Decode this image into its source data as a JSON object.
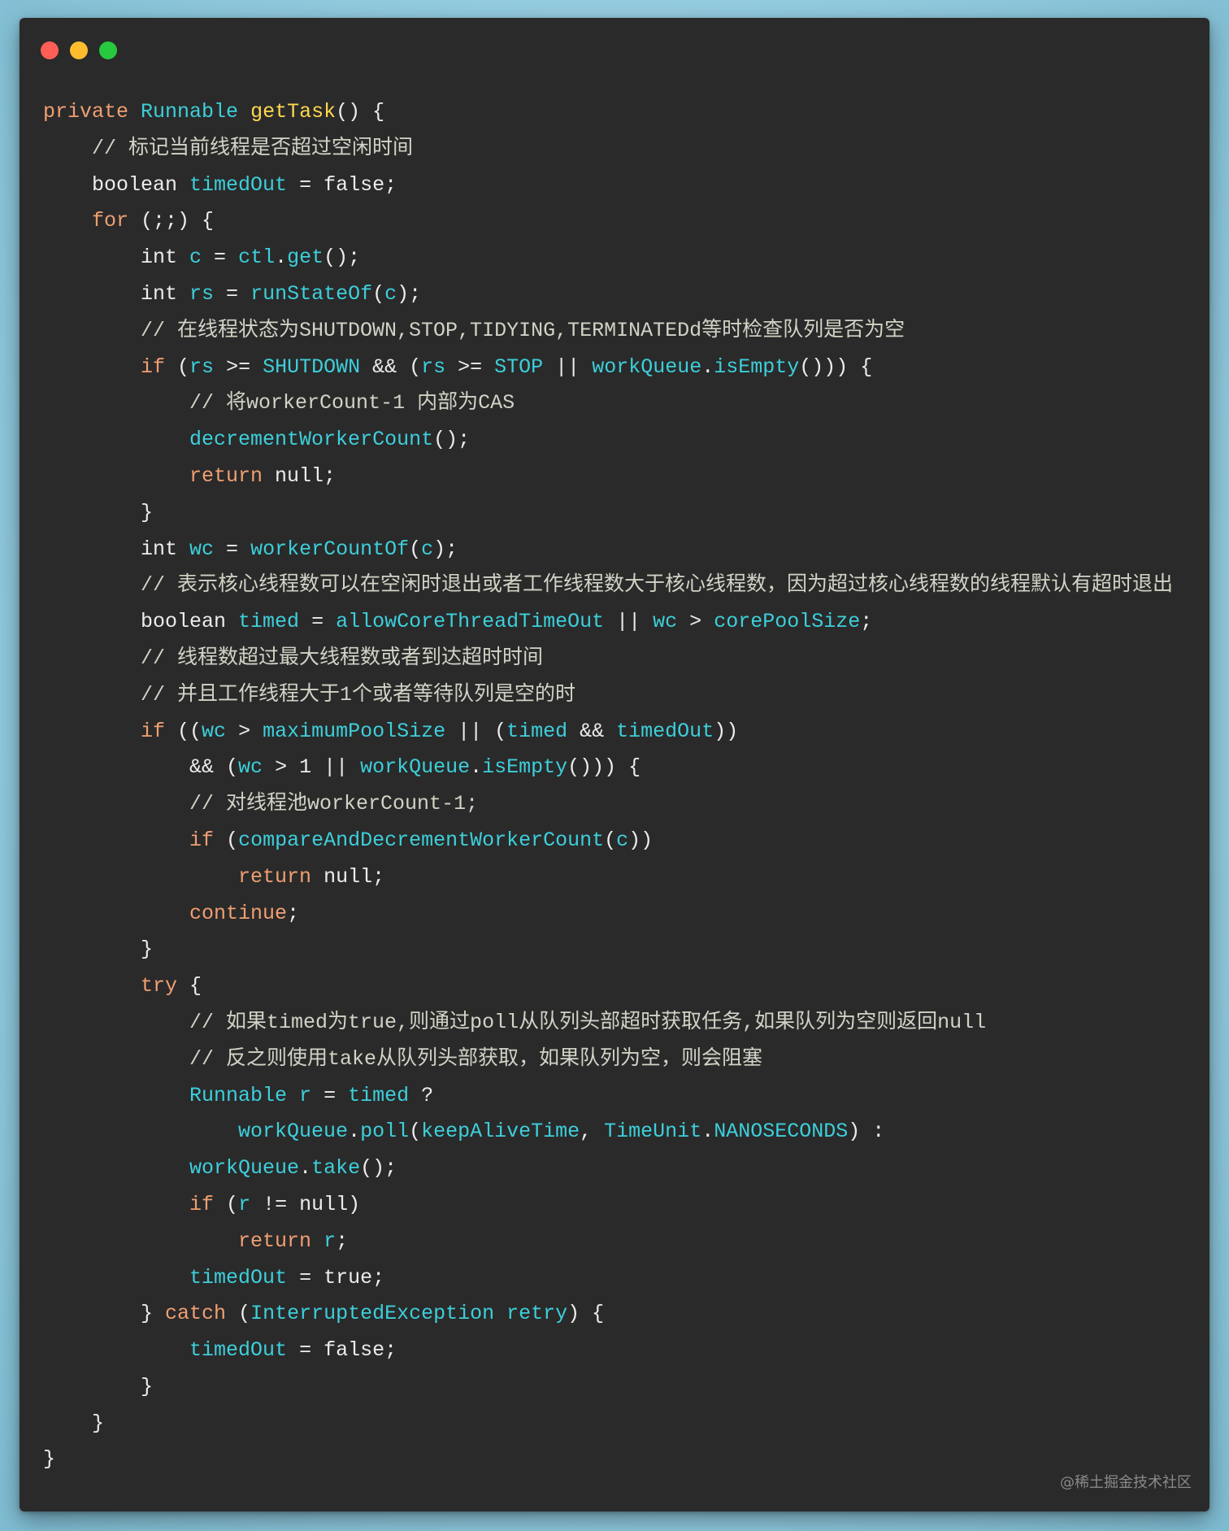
{
  "window": {
    "controls": [
      {
        "icon": "close-icon",
        "color": "#ff5f56"
      },
      {
        "icon": "minimize-icon",
        "color": "#ffbd2e"
      },
      {
        "icon": "maximize-icon",
        "color": "#27c93f"
      }
    ]
  },
  "theme": {
    "window_bg": "#2a2a2a",
    "keyword": "#f09f72",
    "identifier": "#3dcfdb",
    "function": "#ffd84d",
    "plain": "#ececec",
    "comment": "#d2d2c6",
    "watermark": "#8a8a8a"
  },
  "code": {
    "lines": [
      [
        {
          "kw": "private "
        },
        {
          "id": "Runnable "
        },
        {
          "fn": "getTask"
        },
        {
          "pl": "() {"
        }
      ],
      [
        {
          "cm": "    // 标记当前线程是否超过空闲时间"
        }
      ],
      [
        {
          "pl": "    boolean "
        },
        {
          "id": "timedOut"
        },
        {
          "pl": " = false;"
        }
      ],
      [
        {
          "kw": "    for"
        },
        {
          "pl": " (;;) {"
        }
      ],
      [
        {
          "pl": "        int "
        },
        {
          "id": "c"
        },
        {
          "pl": " = "
        },
        {
          "id": "ctl"
        },
        {
          "pl": "."
        },
        {
          "id": "get"
        },
        {
          "pl": "();"
        }
      ],
      [
        {
          "pl": "        int "
        },
        {
          "id": "rs"
        },
        {
          "pl": " = "
        },
        {
          "id": "runStateOf"
        },
        {
          "pl": "("
        },
        {
          "id": "c"
        },
        {
          "pl": ");"
        }
      ],
      [
        {
          "cm": "        // 在线程状态为SHUTDOWN,STOP,TIDYING,TERMINATEDd等时检查队列是否为空"
        }
      ],
      [
        {
          "kw": "        if"
        },
        {
          "pl": " ("
        },
        {
          "id": "rs"
        },
        {
          "pl": " >= "
        },
        {
          "id": "SHUTDOWN"
        },
        {
          "pl": " && ("
        },
        {
          "id": "rs"
        },
        {
          "pl": " >= "
        },
        {
          "id": "STOP"
        },
        {
          "pl": " || "
        },
        {
          "id": "workQueue"
        },
        {
          "pl": "."
        },
        {
          "id": "isEmpty"
        },
        {
          "pl": "())) {"
        }
      ],
      [
        {
          "cm": "            // 将workerCount-1 内部为CAS"
        }
      ],
      [
        {
          "id": "            decrementWorkerCount"
        },
        {
          "pl": "();"
        }
      ],
      [
        {
          "kw": "            return"
        },
        {
          "pl": " null;"
        }
      ],
      [
        {
          "pl": "        }"
        }
      ],
      [
        {
          "pl": "        int "
        },
        {
          "id": "wc"
        },
        {
          "pl": " = "
        },
        {
          "id": "workerCountOf"
        },
        {
          "pl": "("
        },
        {
          "id": "c"
        },
        {
          "pl": ");"
        }
      ],
      [
        {
          "cm": "        // 表示核心线程数可以在空闲时退出或者工作线程数大于核心线程数，因为超过核心线程数的线程默认有超时退出"
        }
      ],
      [
        {
          "pl": "        boolean "
        },
        {
          "id": "timed"
        },
        {
          "pl": " = "
        },
        {
          "id": "allowCoreThreadTimeOut"
        },
        {
          "pl": " || "
        },
        {
          "id": "wc"
        },
        {
          "pl": " > "
        },
        {
          "id": "corePoolSize"
        },
        {
          "pl": ";"
        }
      ],
      [
        {
          "cm": "        // 线程数超过最大线程数或者到达超时时间"
        }
      ],
      [
        {
          "cm": "        // 并且工作线程大于1个或者等待队列是空的时"
        }
      ],
      [
        {
          "kw": "        if"
        },
        {
          "pl": " (("
        },
        {
          "id": "wc"
        },
        {
          "pl": " > "
        },
        {
          "id": "maximumPoolSize"
        },
        {
          "pl": " || ("
        },
        {
          "id": "timed"
        },
        {
          "pl": " && "
        },
        {
          "id": "timedOut"
        },
        {
          "pl": "))"
        }
      ],
      [
        {
          "pl": "            && ("
        },
        {
          "id": "wc"
        },
        {
          "pl": " > 1 || "
        },
        {
          "id": "workQueue"
        },
        {
          "pl": "."
        },
        {
          "id": "isEmpty"
        },
        {
          "pl": "())) {"
        }
      ],
      [
        {
          "cm": "            // 对线程池workerCount-1;"
        }
      ],
      [
        {
          "kw": "            if"
        },
        {
          "pl": " ("
        },
        {
          "id": "compareAndDecrementWorkerCount"
        },
        {
          "pl": "("
        },
        {
          "id": "c"
        },
        {
          "pl": "))"
        }
      ],
      [
        {
          "kw": "                return"
        },
        {
          "pl": " null;"
        }
      ],
      [
        {
          "kw": "            continue"
        },
        {
          "pl": ";"
        }
      ],
      [
        {
          "pl": "        }"
        }
      ],
      [
        {
          "kw": "        try"
        },
        {
          "pl": " {"
        }
      ],
      [
        {
          "cm": "            // 如果timed为true,则通过poll从队列头部超时获取任务,如果队列为空则返回null"
        }
      ],
      [
        {
          "cm": "            // 反之则使用take从队列头部获取，如果队列为空，则会阻塞"
        }
      ],
      [
        {
          "id": "            Runnable r"
        },
        {
          "pl": " = "
        },
        {
          "id": "timed"
        },
        {
          "pl": " ?"
        }
      ],
      [
        {
          "id": "                workQueue"
        },
        {
          "pl": "."
        },
        {
          "id": "poll"
        },
        {
          "pl": "("
        },
        {
          "id": "keepAliveTime"
        },
        {
          "pl": ", "
        },
        {
          "id": "TimeUnit"
        },
        {
          "pl": "."
        },
        {
          "id": "NANOSECONDS"
        },
        {
          "pl": ") :"
        }
      ],
      [
        {
          "id": "            workQueue"
        },
        {
          "pl": "."
        },
        {
          "id": "take"
        },
        {
          "pl": "();"
        }
      ],
      [
        {
          "kw": "            if"
        },
        {
          "pl": " ("
        },
        {
          "id": "r"
        },
        {
          "pl": " != null)"
        }
      ],
      [
        {
          "kw": "                return "
        },
        {
          "id": "r"
        },
        {
          "pl": ";"
        }
      ],
      [
        {
          "id": "            timedOut"
        },
        {
          "pl": " = true;"
        }
      ],
      [
        {
          "pl": "        } "
        },
        {
          "kw": "catch"
        },
        {
          "pl": " ("
        },
        {
          "id": "InterruptedException retry"
        },
        {
          "pl": ") {"
        }
      ],
      [
        {
          "id": "            timedOut"
        },
        {
          "pl": " = false;"
        }
      ],
      [
        {
          "pl": "        }"
        }
      ],
      [
        {
          "pl": "    }"
        }
      ],
      [
        {
          "pl": "}"
        }
      ]
    ]
  },
  "watermark": "@稀土掘金技术社区"
}
